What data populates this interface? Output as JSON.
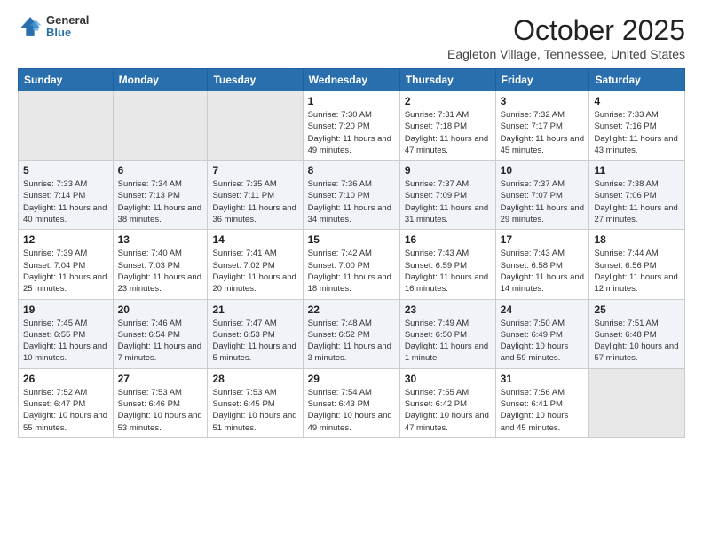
{
  "header": {
    "logo_general": "General",
    "logo_blue": "Blue",
    "month": "October 2025",
    "location": "Eagleton Village, Tennessee, United States"
  },
  "days_of_week": [
    "Sunday",
    "Monday",
    "Tuesday",
    "Wednesday",
    "Thursday",
    "Friday",
    "Saturday"
  ],
  "weeks": [
    [
      {
        "num": "",
        "info": ""
      },
      {
        "num": "",
        "info": ""
      },
      {
        "num": "",
        "info": ""
      },
      {
        "num": "1",
        "info": "Sunrise: 7:30 AM\nSunset: 7:20 PM\nDaylight: 11 hours and 49 minutes."
      },
      {
        "num": "2",
        "info": "Sunrise: 7:31 AM\nSunset: 7:18 PM\nDaylight: 11 hours and 47 minutes."
      },
      {
        "num": "3",
        "info": "Sunrise: 7:32 AM\nSunset: 7:17 PM\nDaylight: 11 hours and 45 minutes."
      },
      {
        "num": "4",
        "info": "Sunrise: 7:33 AM\nSunset: 7:16 PM\nDaylight: 11 hours and 43 minutes."
      }
    ],
    [
      {
        "num": "5",
        "info": "Sunrise: 7:33 AM\nSunset: 7:14 PM\nDaylight: 11 hours and 40 minutes."
      },
      {
        "num": "6",
        "info": "Sunrise: 7:34 AM\nSunset: 7:13 PM\nDaylight: 11 hours and 38 minutes."
      },
      {
        "num": "7",
        "info": "Sunrise: 7:35 AM\nSunset: 7:11 PM\nDaylight: 11 hours and 36 minutes."
      },
      {
        "num": "8",
        "info": "Sunrise: 7:36 AM\nSunset: 7:10 PM\nDaylight: 11 hours and 34 minutes."
      },
      {
        "num": "9",
        "info": "Sunrise: 7:37 AM\nSunset: 7:09 PM\nDaylight: 11 hours and 31 minutes."
      },
      {
        "num": "10",
        "info": "Sunrise: 7:37 AM\nSunset: 7:07 PM\nDaylight: 11 hours and 29 minutes."
      },
      {
        "num": "11",
        "info": "Sunrise: 7:38 AM\nSunset: 7:06 PM\nDaylight: 11 hours and 27 minutes."
      }
    ],
    [
      {
        "num": "12",
        "info": "Sunrise: 7:39 AM\nSunset: 7:04 PM\nDaylight: 11 hours and 25 minutes."
      },
      {
        "num": "13",
        "info": "Sunrise: 7:40 AM\nSunset: 7:03 PM\nDaylight: 11 hours and 23 minutes."
      },
      {
        "num": "14",
        "info": "Sunrise: 7:41 AM\nSunset: 7:02 PM\nDaylight: 11 hours and 20 minutes."
      },
      {
        "num": "15",
        "info": "Sunrise: 7:42 AM\nSunset: 7:00 PM\nDaylight: 11 hours and 18 minutes."
      },
      {
        "num": "16",
        "info": "Sunrise: 7:43 AM\nSunset: 6:59 PM\nDaylight: 11 hours and 16 minutes."
      },
      {
        "num": "17",
        "info": "Sunrise: 7:43 AM\nSunset: 6:58 PM\nDaylight: 11 hours and 14 minutes."
      },
      {
        "num": "18",
        "info": "Sunrise: 7:44 AM\nSunset: 6:56 PM\nDaylight: 11 hours and 12 minutes."
      }
    ],
    [
      {
        "num": "19",
        "info": "Sunrise: 7:45 AM\nSunset: 6:55 PM\nDaylight: 11 hours and 10 minutes."
      },
      {
        "num": "20",
        "info": "Sunrise: 7:46 AM\nSunset: 6:54 PM\nDaylight: 11 hours and 7 minutes."
      },
      {
        "num": "21",
        "info": "Sunrise: 7:47 AM\nSunset: 6:53 PM\nDaylight: 11 hours and 5 minutes."
      },
      {
        "num": "22",
        "info": "Sunrise: 7:48 AM\nSunset: 6:52 PM\nDaylight: 11 hours and 3 minutes."
      },
      {
        "num": "23",
        "info": "Sunrise: 7:49 AM\nSunset: 6:50 PM\nDaylight: 11 hours and 1 minute."
      },
      {
        "num": "24",
        "info": "Sunrise: 7:50 AM\nSunset: 6:49 PM\nDaylight: 10 hours and 59 minutes."
      },
      {
        "num": "25",
        "info": "Sunrise: 7:51 AM\nSunset: 6:48 PM\nDaylight: 10 hours and 57 minutes."
      }
    ],
    [
      {
        "num": "26",
        "info": "Sunrise: 7:52 AM\nSunset: 6:47 PM\nDaylight: 10 hours and 55 minutes."
      },
      {
        "num": "27",
        "info": "Sunrise: 7:53 AM\nSunset: 6:46 PM\nDaylight: 10 hours and 53 minutes."
      },
      {
        "num": "28",
        "info": "Sunrise: 7:53 AM\nSunset: 6:45 PM\nDaylight: 10 hours and 51 minutes."
      },
      {
        "num": "29",
        "info": "Sunrise: 7:54 AM\nSunset: 6:43 PM\nDaylight: 10 hours and 49 minutes."
      },
      {
        "num": "30",
        "info": "Sunrise: 7:55 AM\nSunset: 6:42 PM\nDaylight: 10 hours and 47 minutes."
      },
      {
        "num": "31",
        "info": "Sunrise: 7:56 AM\nSunset: 6:41 PM\nDaylight: 10 hours and 45 minutes."
      },
      {
        "num": "",
        "info": ""
      }
    ]
  ]
}
